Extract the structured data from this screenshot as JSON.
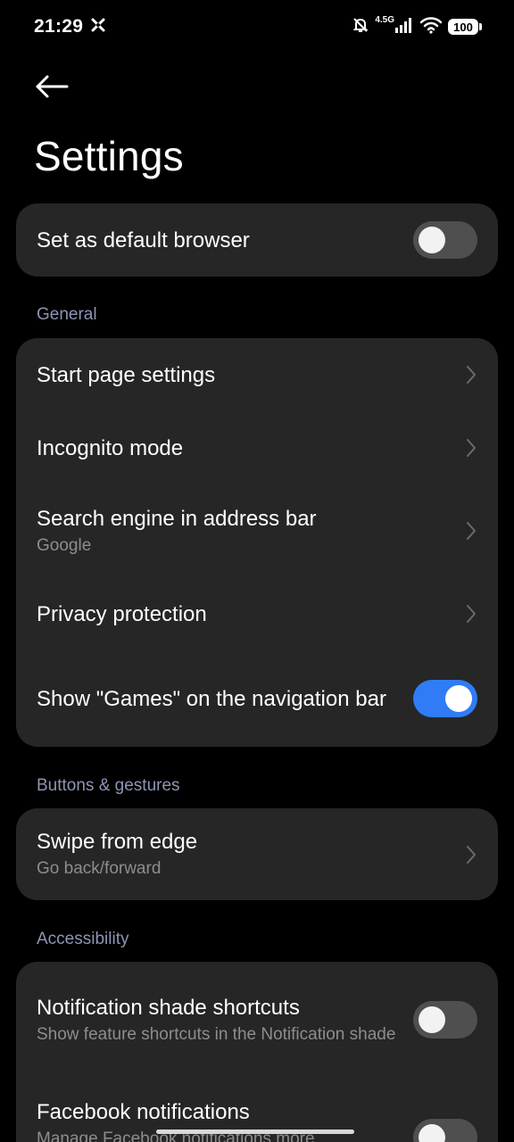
{
  "status_bar": {
    "time": "21:29",
    "network": "4.5G",
    "battery": "100",
    "icons": [
      "tools-icon",
      "bell-off-icon",
      "signal-icon",
      "wifi-icon",
      "battery-icon"
    ]
  },
  "header": {
    "back_icon": "arrow-left-icon",
    "title": "Settings"
  },
  "default_browser": {
    "label": "Set as default browser",
    "enabled": false
  },
  "sections": {
    "general": {
      "label": "General",
      "items": [
        {
          "title": "Start page settings"
        },
        {
          "title": "Incognito mode"
        },
        {
          "title": "Search engine in address bar",
          "subtitle": "Google"
        },
        {
          "title": "Privacy protection"
        },
        {
          "title": "Show \"Games\" on the navigation bar",
          "enabled": true
        }
      ]
    },
    "buttons_gestures": {
      "label": "Buttons & gestures",
      "items": [
        {
          "title": "Swipe from edge",
          "subtitle": "Go back/forward"
        }
      ]
    },
    "accessibility": {
      "label": "Accessibility",
      "items": [
        {
          "title": "Notification shade shortcuts",
          "subtitle": "Show feature shortcuts in the Notification shade",
          "enabled": false
        },
        {
          "title": "Facebook notifications",
          "subtitle": "Manage Facebook notifications more",
          "enabled": false
        }
      ]
    }
  },
  "colors": {
    "background": "#000000",
    "card": "#262626",
    "toggle_on": "#2f7cf6",
    "toggle_off": "#4f4f4f",
    "section_label": "#8f95b4",
    "subtitle": "#8d8d8d"
  }
}
